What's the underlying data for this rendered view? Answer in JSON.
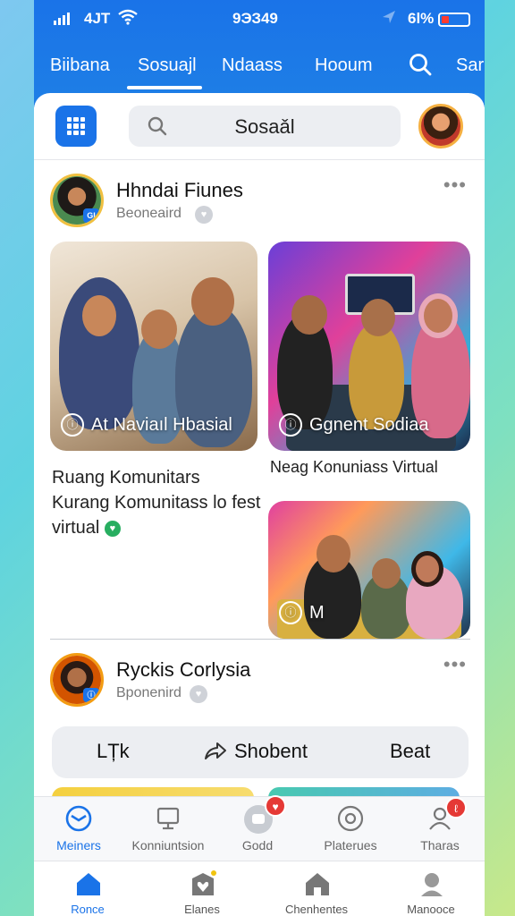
{
  "status": {
    "carrier": "4JT",
    "time": "9ЭЗ49",
    "battery_pct": "6l%",
    "battery_color": "#ff3b30"
  },
  "tabs": [
    {
      "label": "Biibana"
    },
    {
      "label": "Sosuaјl",
      "active": true
    },
    {
      "label": "Ndaass"
    },
    {
      "label": "Hooum"
    },
    {
      "label": "Sar"
    }
  ],
  "appbar": {
    "search_text": "Sosaǎl"
  },
  "posts": [
    {
      "name": "Hhndai Fiunes",
      "sub": "Beoneaird",
      "avatar_badge": "GI",
      "photo_captions": [
        "At Naviaıl Hbasial",
        "Gɡnent Sodiaa",
        "M"
      ],
      "text_title": "Ruang Komunitars",
      "text_body": "Kurang Komunitass lo fest",
      "text_body_2": "virtual",
      "right_caption": "Neag Konuniass Virtual"
    },
    {
      "name": "Ryckis Corlysia",
      "sub": "Bponenird"
    }
  ],
  "actions": {
    "like": "LȚk",
    "share": "Shobent",
    "beat": "Beat"
  },
  "nav_top": [
    {
      "label": "Meiners",
      "icon": "mail-icon",
      "active": true
    },
    {
      "label": "Konniuntsion",
      "icon": "monitor-icon"
    },
    {
      "label": "Godd",
      "icon": "game-icon",
      "badge": ""
    },
    {
      "label": "Platerues",
      "icon": "compass-icon"
    },
    {
      "label": "Tharas",
      "icon": "person-icon",
      "badge": ""
    }
  ],
  "nav_bottom": [
    {
      "label": "Ronce",
      "icon": "home-icon",
      "active": true
    },
    {
      "label": "Elanes",
      "icon": "heart-box-icon"
    },
    {
      "label": "Chenhentes",
      "icon": "house-icon"
    },
    {
      "label": "Manooce",
      "icon": "user-icon"
    }
  ],
  "colors": {
    "primary": "#1a73e8",
    "verified": "#27ae60",
    "badge": "#e53935"
  }
}
